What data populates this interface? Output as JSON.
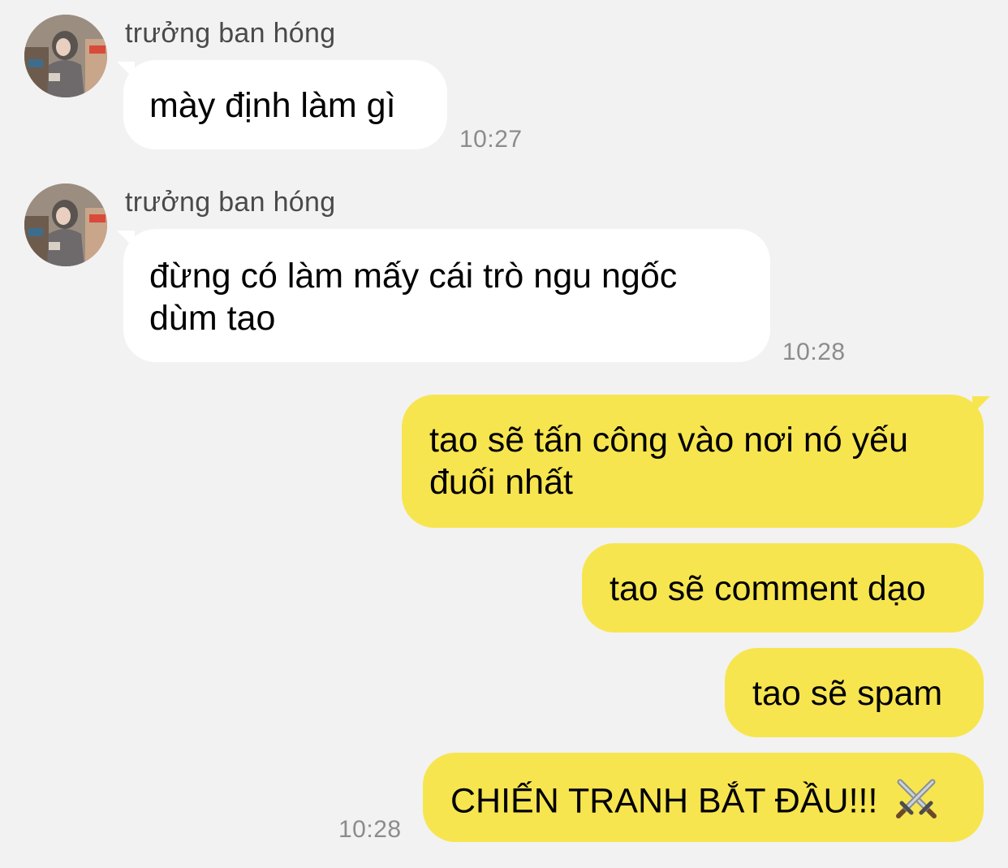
{
  "conversation": {
    "incoming": [
      {
        "sender": "trưởng ban hóng",
        "lines": [
          "mày định làm gì"
        ],
        "time": "10:27"
      },
      {
        "sender": "trưởng ban hóng",
        "lines": [
          "đừng có làm mấy cái trò ngu ngốc",
          "dùm tao"
        ],
        "time": "10:28"
      }
    ],
    "outgoing": [
      {
        "lines": [
          "tao sẽ tấn công vào nơi nó yếu",
          "đuối nhất"
        ]
      },
      {
        "lines": [
          "tao sẽ comment dạo"
        ]
      },
      {
        "lines": [
          "tao sẽ spam"
        ]
      },
      {
        "lines": [
          "CHIẾN TRANH BẮT ĐẦU!!!"
        ],
        "emoji": "crossed-swords-icon"
      }
    ],
    "outgoing_time": "10:28"
  },
  "colors": {
    "background": "#f2f2f2",
    "incoming_bubble": "#ffffff",
    "outgoing_bubble": "#f7e54f",
    "timestamp": "#8c8c8c",
    "sender_name": "#4a4a4a"
  }
}
